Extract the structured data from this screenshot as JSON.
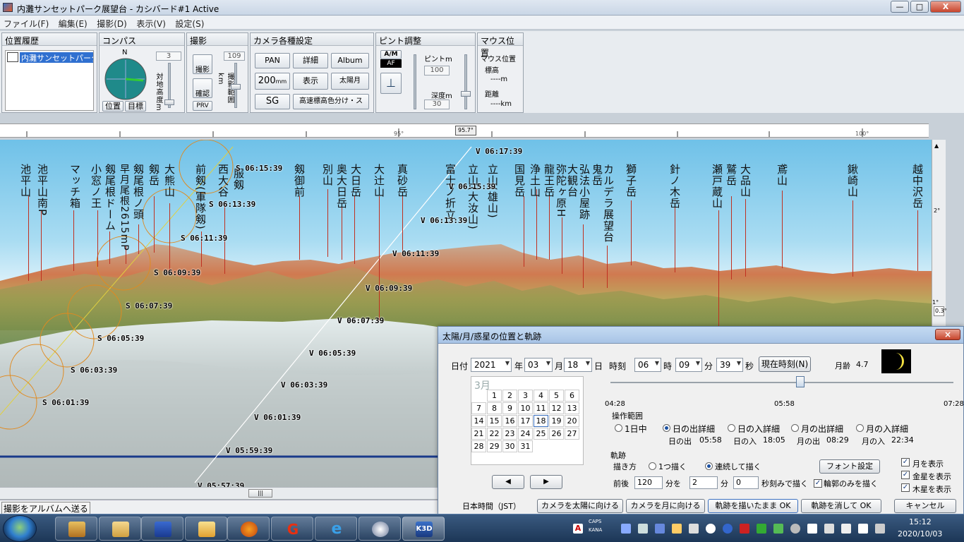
{
  "window": {
    "title": "内灘サンセットパーク展望台 - カシバード#1 Active",
    "minimize": "—",
    "maximize": "□",
    "close": "X"
  },
  "menu": [
    "ファイル(F)",
    "編集(E)",
    "撮影(D)",
    "表示(V)",
    "設定(S)"
  ],
  "panels": {
    "history": {
      "title": "位置履歴",
      "item": "内灘サンセットパーク展"
    },
    "compass": {
      "title": "コンパス",
      "north": "N",
      "value": "3",
      "vlabel": "対地高度m",
      "btn_pos": "位置",
      "btn_target": "目標"
    },
    "shoot": {
      "title": "撮影",
      "btn_shoot": "撮影",
      "btn_confirm": "確認",
      "btn_prv": "PRV",
      "value": "109",
      "vlabel": "撮影範囲km"
    },
    "camera": {
      "title": "カメラ各種設定",
      "pan": "PAN",
      "detail": "詳細",
      "album": "Album",
      "mm": "200",
      "mm_unit": "mm",
      "display": "表示",
      "sunmoon": "太陽月",
      "sg": "SG",
      "color": "高速標高色分け・ス"
    },
    "focus": {
      "title": "ピント調整",
      "am": "A/M",
      "af": "AF",
      "focus_label": "ピントm",
      "focus_value": "100",
      "depth_label": "深度m",
      "depth_value": "30"
    },
    "mouse": {
      "title": "マウス位置",
      "label1": "マウス位置",
      "label2": "標高",
      "value1": "----m",
      "label3": "距離",
      "value2": "----km"
    }
  },
  "ruler": {
    "ticks": [
      "95°",
      "100°"
    ],
    "marker": "95.7°"
  },
  "scroll_labels": {
    "v1": "2°",
    "v2": "1°",
    "v3": "0.3°"
  },
  "peaks": [
    {
      "name": "池平山"
    },
    {
      "name": "池平山南P"
    },
    {
      "name": "マッチ箱"
    },
    {
      "name": "小窓ノ王"
    },
    {
      "name": "剱尾根ドーム"
    },
    {
      "name": "早月尾根2615mP"
    },
    {
      "name": "剱尾根ノ頭"
    },
    {
      "name": "剱岳"
    },
    {
      "name": "大熊山"
    },
    {
      "name": "前剱(軍隊剱)"
    },
    {
      "name": "西大谷"
    },
    {
      "name": "服剱"
    },
    {
      "name": "剱御前"
    },
    {
      "name": "別山"
    },
    {
      "name": "奥大日岳"
    },
    {
      "name": "大日岳"
    },
    {
      "name": "大辻山"
    },
    {
      "name": "真砂岳"
    },
    {
      "name": "富士ノ折立"
    },
    {
      "name": "立山(大汝山)"
    },
    {
      "name": "立山(雄山)"
    },
    {
      "name": "国見岳"
    },
    {
      "name": "浄土山"
    },
    {
      "name": "龍王岳"
    },
    {
      "name": "弥陀ヶ原H"
    },
    {
      "name": "大観台"
    },
    {
      "name": "弘法小屋跡"
    },
    {
      "name": "鬼岳"
    },
    {
      "name": "カルデラ展望台"
    },
    {
      "name": "獅子岳"
    },
    {
      "name": "針ノ木岳"
    },
    {
      "name": "瀬戸蔵山"
    },
    {
      "name": "鷲岳"
    },
    {
      "name": "大品山"
    },
    {
      "name": "鳶山"
    },
    {
      "name": "鍬崎山"
    },
    {
      "name": "越中沢岳"
    }
  ],
  "tracks": {
    "sun": [
      "S 06:15:39",
      "S 06:13:39",
      "S 06:11:39",
      "S 06:09:39",
      "S 06:07:39",
      "S 06:05:39",
      "S 06:03:39",
      "S 06:01:39"
    ],
    "venus": [
      "V 06:17:39",
      "V 06:15:39",
      "V 06:13:39",
      "V 06:11:39",
      "V 06:09:39",
      "V 06:07:39",
      "V 06:05:39",
      "V 06:03:39",
      "V 06:01:39",
      "V 05:59:39",
      "V 05:57:39"
    ]
  },
  "status": "撮影をアルバムへ送る",
  "dialog": {
    "title": "太陽/月/惑星の位置と軌跡",
    "date_label": "日付",
    "year": "2021",
    "year_unit": "年",
    "month": "03",
    "month_unit": "月",
    "day": "18",
    "day_unit": "日",
    "time_label": "時刻",
    "hour": "06",
    "hour_unit": "時",
    "minute": "09",
    "minute_unit": "分",
    "second": "39",
    "second_unit": "秒",
    "now_btn": "現在時刻(N)",
    "moon_age_label": "月齢",
    "moon_age": "4.7",
    "calendar": {
      "month": "3月",
      "days": [
        "1",
        "2",
        "3",
        "4",
        "5",
        "6",
        "7",
        "8",
        "9",
        "10",
        "11",
        "12",
        "13",
        "14",
        "15",
        "16",
        "17",
        "18",
        "19",
        "20",
        "21",
        "22",
        "23",
        "24",
        "25",
        "26",
        "27",
        "28",
        "29",
        "30",
        "31"
      ]
    },
    "slider": {
      "start": "04:28",
      "mid": "05:58",
      "end": "07:28",
      "value_fraction": 0.5
    },
    "range_label": "操作範囲",
    "radios": [
      "1日中",
      "日の出詳細",
      "日の入詳細",
      "月の出詳細",
      "月の入詳細"
    ],
    "rise_set": [
      {
        "label": "日の出",
        "value": "05:58"
      },
      {
        "label": "日の入",
        "value": "18:05"
      },
      {
        "label": "月の出",
        "value": "08:29"
      },
      {
        "label": "月の入",
        "value": "22:34"
      }
    ],
    "track_label": "軌跡",
    "draw_label": "描き方",
    "draw_once": "1つ描く",
    "draw_cont": "連続して描く",
    "font_btn": "フォント設定",
    "before_after": "前後",
    "ba_value": "120",
    "ba_unit": "分を",
    "step_min": "2",
    "step_min_unit": "分",
    "step_sec": "0",
    "step_sec_unit": "秒刻みで描く",
    "outline_only": "輪郭のみを描く",
    "show_moon": "月を表示",
    "show_venus": "金星を表示",
    "show_jupiter": "木星を表示",
    "jst": "日本時間（JST）",
    "btn_sun": "カメラを太陽に向ける",
    "btn_moon": "カメラを月に向ける",
    "btn_keep": "軌跡を描いたまま OK",
    "btn_clear": "軌跡を消して OK",
    "btn_cancel": "キャンセル",
    "prev": "◀",
    "next": "▶"
  },
  "taskbar": {
    "time": "15:12",
    "date": "2020/10/03",
    "caps": "CAPS",
    "kana": "KANA",
    "k3d": "K3D"
  },
  "colors": {
    "sky_top": "#6fc1e8",
    "sun_track": "#e08a20",
    "venus_track": "#ffffff",
    "peak_line": "#c03020",
    "horizon_line": "#1a3a8a"
  }
}
